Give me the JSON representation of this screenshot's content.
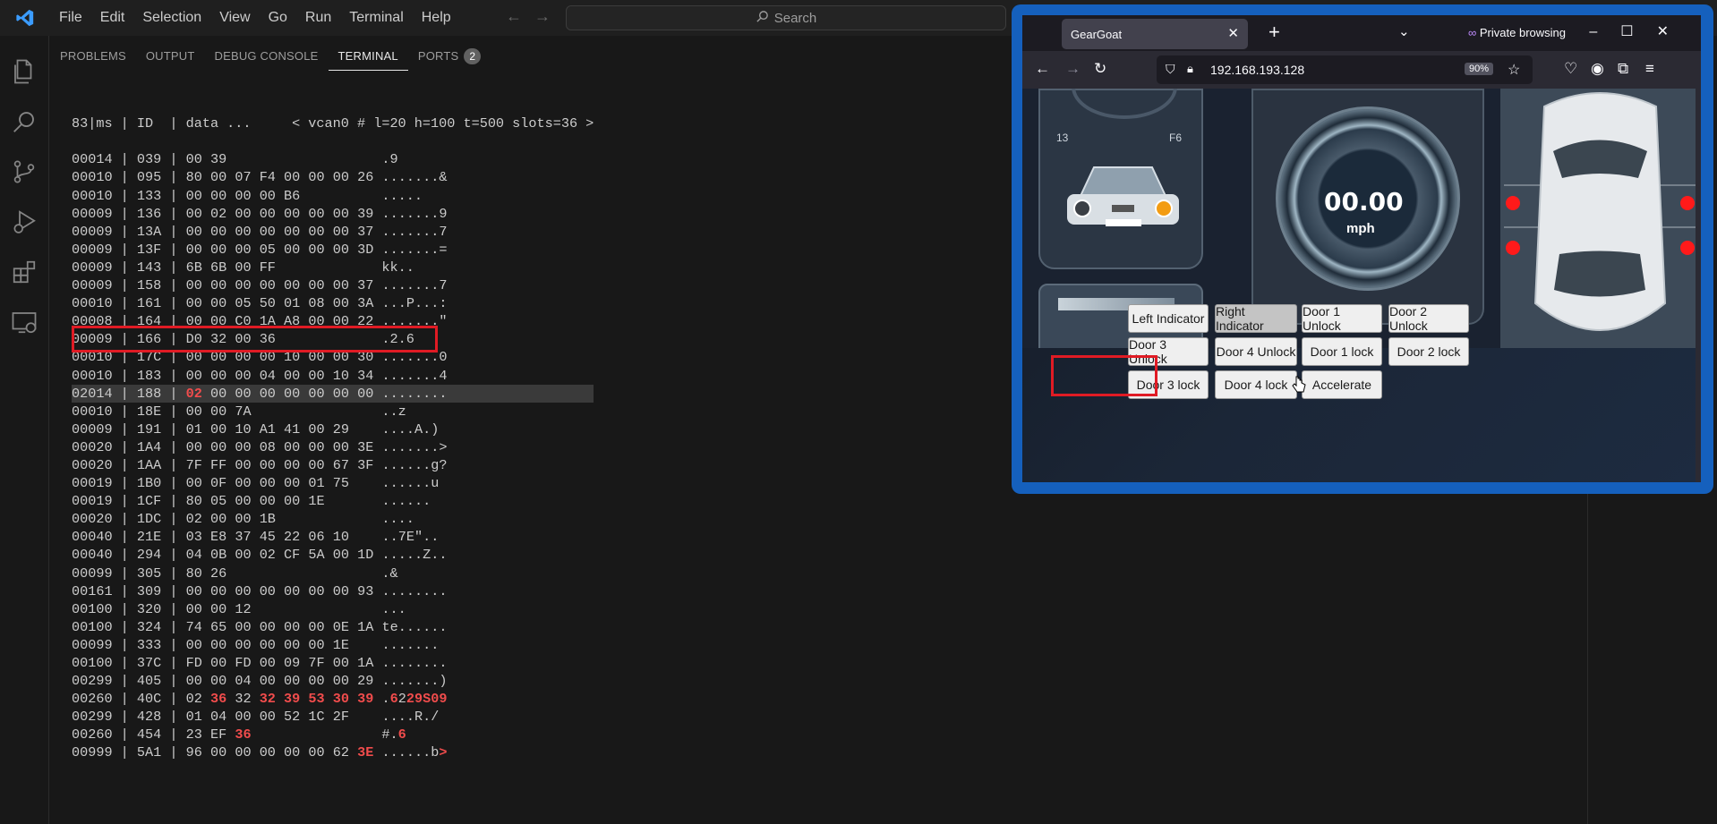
{
  "titlebar": {
    "menu": [
      "File",
      "Edit",
      "Selection",
      "View",
      "Go",
      "Run",
      "Terminal",
      "Help"
    ],
    "search_label": "Search"
  },
  "activitybar": {
    "icons": [
      "explorer-icon",
      "search-icon",
      "source-control-icon",
      "run-debug-icon",
      "extensions-icon",
      "remote-explorer-icon"
    ]
  },
  "panel": {
    "tabs": [
      "PROBLEMS",
      "OUTPUT",
      "DEBUG CONSOLE",
      "TERMINAL",
      "PORTS"
    ],
    "active_tab": "TERMINAL",
    "ports_count": "2"
  },
  "terminal": {
    "header": "83|ms | ID  | data ...     < vcan0 # l=20 h=100 t=500 slots=36 >",
    "rows": [
      {
        "ms": "00014",
        "id": "039",
        "data": "00 39",
        "ascii": ".9"
      },
      {
        "ms": "00010",
        "id": "095",
        "data": "80 00 07 F4 00 00 00 26",
        "ascii": ".......&"
      },
      {
        "ms": "00010",
        "id": "133",
        "data": "00 00 00 00 B6",
        "ascii": "....."
      },
      {
        "ms": "00009",
        "id": "136",
        "data": "00 02 00 00 00 00 00 39",
        "ascii": ".......9"
      },
      {
        "ms": "00009",
        "id": "13A",
        "data": "00 00 00 00 00 00 00 37",
        "ascii": ".......7"
      },
      {
        "ms": "00009",
        "id": "13F",
        "data": "00 00 00 05 00 00 00 3D",
        "ascii": ".......="
      },
      {
        "ms": "00009",
        "id": "143",
        "data": "6B 6B 00 FF",
        "ascii": "kk.."
      },
      {
        "ms": "00009",
        "id": "158",
        "data": "00 00 00 00 00 00 00 37",
        "ascii": ".......7"
      },
      {
        "ms": "00010",
        "id": "161",
        "data": "00 00 05 50 01 08 00 3A",
        "ascii": "...P...:"
      },
      {
        "ms": "00008",
        "id": "164",
        "data": "00 00 C0 1A A8 00 00 22",
        "ascii": ".......\""
      },
      {
        "ms": "00009",
        "id": "166",
        "data": "D0 32 00 36",
        "ascii": ".2.6"
      },
      {
        "ms": "00010",
        "id": "17C",
        "data": "00 00 00 00 10 00 00 30",
        "ascii": ".......0"
      },
      {
        "ms": "00010",
        "id": "183",
        "data": "00 00 00 04 00 00 10 34",
        "ascii": ".......4"
      },
      {
        "ms": "02014",
        "id": "188",
        "data": "02 00 00 00 00 00 00 00",
        "ascii": "........",
        "highlight": true
      },
      {
        "ms": "00010",
        "id": "18E",
        "data": "00 00 7A",
        "ascii": "..z"
      },
      {
        "ms": "00009",
        "id": "191",
        "data": "01 00 10 A1 41 00 29",
        "ascii": "....A.)"
      },
      {
        "ms": "00020",
        "id": "1A4",
        "data": "00 00 00 08 00 00 00 3E",
        "ascii": ".......>"
      },
      {
        "ms": "00020",
        "id": "1AA",
        "data": "7F FF 00 00 00 00 67 3F",
        "ascii": "......g?"
      },
      {
        "ms": "00019",
        "id": "1B0",
        "data": "00 0F 00 00 00 01 75",
        "ascii": "......u"
      },
      {
        "ms": "00019",
        "id": "1CF",
        "data": "80 05 00 00 00 1E",
        "ascii": "......"
      },
      {
        "ms": "00020",
        "id": "1DC",
        "data": "02 00 00 1B",
        "ascii": "...."
      },
      {
        "ms": "00040",
        "id": "21E",
        "data": "03 E8 37 45 22 06 10",
        "ascii": "..7E\".."
      },
      {
        "ms": "00040",
        "id": "294",
        "data": "04 0B 00 02 CF 5A 00 1D",
        "ascii": ".....Z.."
      },
      {
        "ms": "00099",
        "id": "305",
        "data": "80 26",
        "ascii": ".&"
      },
      {
        "ms": "00161",
        "id": "309",
        "data": "00 00 00 00 00 00 00 93",
        "ascii": "........"
      },
      {
        "ms": "00100",
        "id": "320",
        "data": "00 00 12",
        "ascii": "..."
      },
      {
        "ms": "00100",
        "id": "324",
        "data": "74 65 00 00 00 00 0E 1A",
        "ascii": "te......"
      },
      {
        "ms": "00099",
        "id": "333",
        "data": "00 00 00 00 00 00 1E",
        "ascii": "......."
      },
      {
        "ms": "00100",
        "id": "37C",
        "data": "FD 00 FD 00 09 7F 00 1A",
        "ascii": "........"
      },
      {
        "ms": "00299",
        "id": "405",
        "data": "00 00 04 00 00 00 00 29",
        "ascii": ".......)"
      },
      {
        "ms": "00260",
        "id": "40C",
        "data": "02 36 32 32 39 53 30 39",
        "ascii": ".6229S09"
      },
      {
        "ms": "00299",
        "id": "428",
        "data": "01 04 00 00 52 1C 2F",
        "ascii": "....R./"
      },
      {
        "ms": "00260",
        "id": "454",
        "data": "23 EF 36",
        "ascii": "#.6"
      },
      {
        "ms": "00999",
        "id": "5A1",
        "data": "96 00 00 00 00 00 62 3E",
        "ascii": "......b>"
      }
    ]
  },
  "browser": {
    "tab_title": "GearGoat",
    "private_label": "Private browsing",
    "url": "192.168.193.128",
    "zoom": "90%",
    "dashboard": {
      "speed": "00.00",
      "unit": "mph",
      "left_labels": [
        "13",
        "F6"
      ]
    },
    "buttons": [
      "Left Indicator",
      "Right Indicator",
      "Door 1 Unlock",
      "Door 2 Unlock",
      "Door 3 Unlock",
      "Door 4 Unlock",
      "Door 1 lock",
      "Door 2 lock",
      "Door 3 lock",
      "Door 4 lock",
      "Accelerate"
    ]
  }
}
